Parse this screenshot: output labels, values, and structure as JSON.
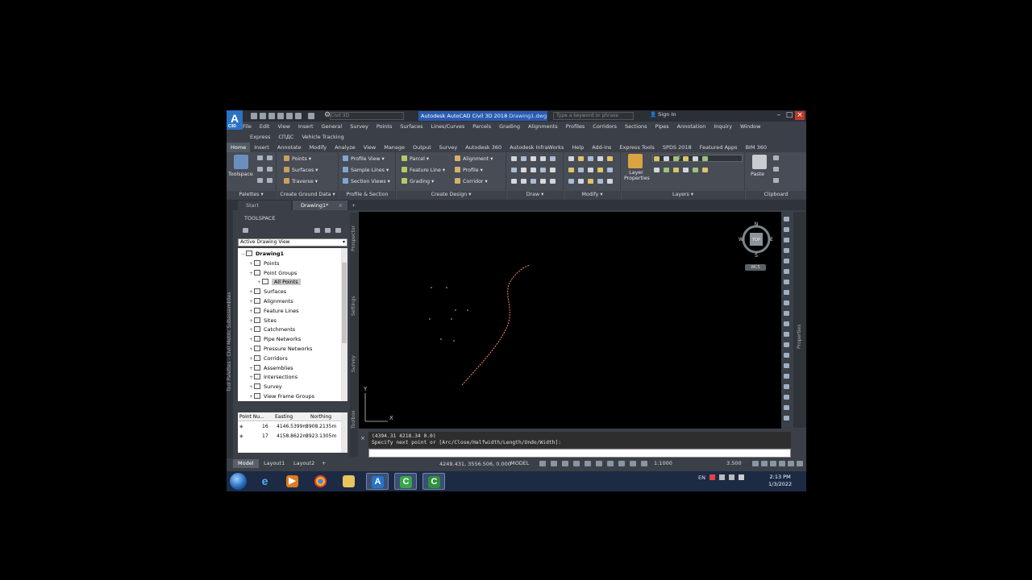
{
  "app": {
    "logo": "A",
    "logo_sub": "C3D",
    "workspace": "Civil 3D",
    "doc_title_app": "Autodesk AutoCAD Civil 3D 2018",
    "doc_title_file": "Drawing1.dwg",
    "search_placeholder": "Type a keyword or phrase",
    "sign_in": "Sign In"
  },
  "menu_row1": [
    "File",
    "Edit",
    "View",
    "Insert",
    "General",
    "Survey",
    "Points",
    "Surfaces",
    "Lines/Curves",
    "Parcels",
    "Grading",
    "Alignments",
    "Profiles",
    "Corridors",
    "Sections",
    "Pipes",
    "Annotation",
    "Inquiry",
    "Window"
  ],
  "menu_row2": [
    "Express",
    "СПДС",
    "Vehicle Tracking"
  ],
  "ribbon_tabs": [
    "Home",
    "Insert",
    "Annotate",
    "Modify",
    "Analyze",
    "View",
    "Manage",
    "Output",
    "Survey",
    "Autodesk 360",
    "Autodesk InfraWorks",
    "Help",
    "Add-ins",
    "Express Tools",
    "SPDS 2018",
    "Featured Apps",
    "BIM 360"
  ],
  "ribbon": {
    "toolspace_label": "Toolspace",
    "palettes": "Palettes",
    "ground_items": [
      "Points",
      "Surfaces",
      "Traverse"
    ],
    "ground_title": "Create Ground Data",
    "profile_items": [
      "Profile View",
      "Sample Lines",
      "Section Views"
    ],
    "profile_title": "Profile & Section Views",
    "design_col1": [
      "Parcel",
      "Feature Line",
      "Grading"
    ],
    "design_col2": [
      "Alignment",
      "Profile",
      "Corridor"
    ],
    "design_title": "Create Design",
    "draw_title": "Draw",
    "modify_title": "Modify",
    "layer_properties": "Layer Properties",
    "layer_value": "0",
    "layers_title": "Layers",
    "paste": "Paste",
    "clipboard_title": "Clipboard"
  },
  "doc_tabs": [
    "Start",
    "Drawing1*"
  ],
  "toolspace": {
    "title": "TOOLSPACE",
    "view_select": "Active Drawing View",
    "tree": [
      {
        "label": "Drawing1",
        "level": 0,
        "bold": true
      },
      {
        "label": "Points",
        "level": 1
      },
      {
        "label": "Point Groups",
        "level": 1
      },
      {
        "label": "All Points",
        "level": 2,
        "selected": true
      },
      {
        "label": "Surfaces",
        "level": 1
      },
      {
        "label": "Alignments",
        "level": 1
      },
      {
        "label": "Feature Lines",
        "level": 1
      },
      {
        "label": "Sites",
        "level": 1
      },
      {
        "label": "Catchments",
        "level": 1
      },
      {
        "label": "Pipe Networks",
        "level": 1
      },
      {
        "label": "Pressure Networks",
        "level": 1
      },
      {
        "label": "Corridors",
        "level": 1
      },
      {
        "label": "Assemblies",
        "level": 1
      },
      {
        "label": "Intersections",
        "level": 1
      },
      {
        "label": "Survey",
        "level": 1
      },
      {
        "label": "View Frame Groups",
        "level": 1
      }
    ],
    "grid_headers": [
      "Point Nu...",
      "Easting",
      "Northing"
    ],
    "grid_rows": [
      [
        "16",
        "4146.5399m",
        "3908.2135m"
      ],
      [
        "17",
        "4158.8622m",
        "3923.1305m"
      ]
    ],
    "side_tabs": [
      "Prospector",
      "Settings",
      "Survey",
      "Toolbox"
    ],
    "palette_tab": "Tool Palettes - Civil Metric Subassemblies"
  },
  "viewcube": {
    "n": "N",
    "s": "S",
    "e": "E",
    "w": "W",
    "top": "TOP",
    "wcs": "WCS"
  },
  "properties_tab": "Properties",
  "command": {
    "line1": "(4394.31 4218.34 0.0)",
    "line2": "Specify next point or [Arc/Close/Halfwidth/Length/Undo/Width]:",
    "input_placeholder": "Type a command"
  },
  "layout_tabs": [
    "Model",
    "Layout1",
    "Layout2"
  ],
  "status": {
    "coords": "4249.431, 3556.506, 0.000",
    "model": "MODEL",
    "scale": "1:1000",
    "value": "3.500"
  },
  "taskbar": {
    "lang": "EN",
    "time": "2:13 PM",
    "date": "1/3/2022"
  },
  "colors": {
    "accent": "#2a5bb0",
    "background": "#3b3f47",
    "canvas": "#000000",
    "polyline": "#ff8a5c"
  }
}
